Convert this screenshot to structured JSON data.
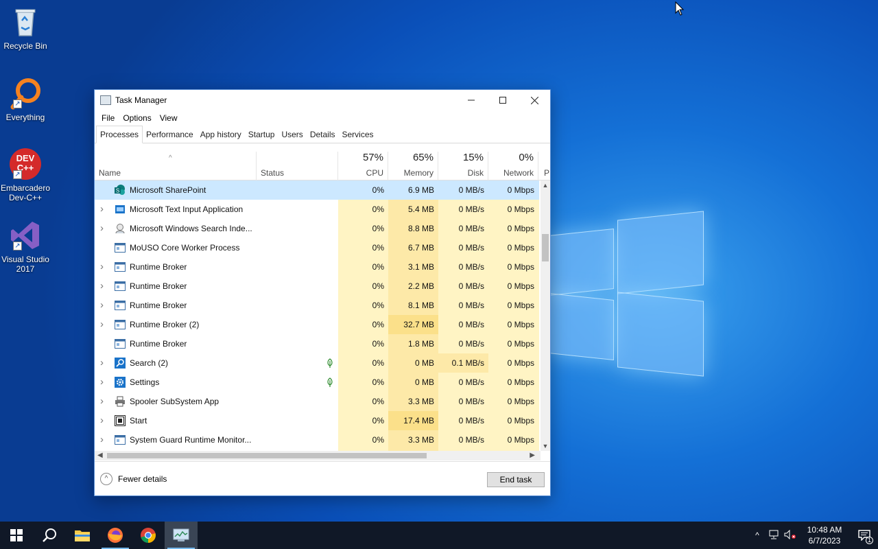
{
  "desktop": {
    "icons": [
      {
        "label": "Recycle Bin"
      },
      {
        "label": "Everything"
      },
      {
        "label": "Embarcadero Dev-C++",
        "glyph": "DEV C++"
      },
      {
        "label": "Visual Studio 2017"
      }
    ]
  },
  "window": {
    "title": "Task Manager",
    "menu": [
      "File",
      "Options",
      "View"
    ],
    "tabs": [
      "Processes",
      "Performance",
      "App history",
      "Startup",
      "Users",
      "Details",
      "Services"
    ],
    "active_tab": "Processes",
    "columns": {
      "name": "Name",
      "status": "Status",
      "cpu": {
        "pct": "57%",
        "label": "CPU"
      },
      "memory": {
        "pct": "65%",
        "label": "Memory"
      },
      "disk": {
        "pct": "15%",
        "label": "Disk"
      },
      "network": {
        "pct": "0%",
        "label": "Network"
      },
      "power": "P"
    },
    "processes": [
      {
        "name": "Microsoft SharePoint",
        "cpu": "0%",
        "memory": "6.9 MB",
        "disk": "0 MB/s",
        "network": "0 Mbps",
        "expandable": false,
        "icon": "sharepoint-icon",
        "selected": true
      },
      {
        "name": "Microsoft Text Input Application",
        "cpu": "0%",
        "memory": "5.4 MB",
        "disk": "0 MB/s",
        "network": "0 Mbps",
        "expandable": true,
        "icon": "app-icon"
      },
      {
        "name": "Microsoft Windows Search Inde...",
        "cpu": "0%",
        "memory": "8.8 MB",
        "disk": "0 MB/s",
        "network": "0 Mbps",
        "expandable": true,
        "icon": "search-indexer-icon"
      },
      {
        "name": "MoUSO Core Worker Process",
        "cpu": "0%",
        "memory": "6.7 MB",
        "disk": "0 MB/s",
        "network": "0 Mbps",
        "expandable": false,
        "icon": "process-icon"
      },
      {
        "name": "Runtime Broker",
        "cpu": "0%",
        "memory": "3.1 MB",
        "disk": "0 MB/s",
        "network": "0 Mbps",
        "expandable": true,
        "icon": "process-icon"
      },
      {
        "name": "Runtime Broker",
        "cpu": "0%",
        "memory": "2.2 MB",
        "disk": "0 MB/s",
        "network": "0 Mbps",
        "expandable": true,
        "icon": "process-icon"
      },
      {
        "name": "Runtime Broker",
        "cpu": "0%",
        "memory": "8.1 MB",
        "disk": "0 MB/s",
        "network": "0 Mbps",
        "expandable": true,
        "icon": "process-icon"
      },
      {
        "name": "Runtime Broker (2)",
        "cpu": "0%",
        "memory": "32.7 MB",
        "disk": "0 MB/s",
        "network": "0 Mbps",
        "expandable": true,
        "icon": "process-icon"
      },
      {
        "name": "Runtime Broker",
        "cpu": "0%",
        "memory": "1.8 MB",
        "disk": "0 MB/s",
        "network": "0 Mbps",
        "expandable": false,
        "icon": "process-icon"
      },
      {
        "name": "Search (2)",
        "cpu": "0%",
        "memory": "0 MB",
        "disk": "0.1 MB/s",
        "network": "0 Mbps",
        "expandable": true,
        "icon": "search-icon",
        "suspended": true
      },
      {
        "name": "Settings",
        "cpu": "0%",
        "memory": "0 MB",
        "disk": "0 MB/s",
        "network": "0 Mbps",
        "expandable": true,
        "icon": "gear-icon",
        "suspended": true
      },
      {
        "name": "Spooler SubSystem App",
        "cpu": "0%",
        "memory": "3.3 MB",
        "disk": "0 MB/s",
        "network": "0 Mbps",
        "expandable": true,
        "icon": "printer-icon"
      },
      {
        "name": "Start",
        "cpu": "0%",
        "memory": "17.4 MB",
        "disk": "0 MB/s",
        "network": "0 Mbps",
        "expandable": true,
        "icon": "start-app-icon"
      },
      {
        "name": "System Guard Runtime Monitor...",
        "cpu": "0%",
        "memory": "3.3 MB",
        "disk": "0 MB/s",
        "network": "0 Mbps",
        "expandable": true,
        "icon": "process-icon"
      }
    ],
    "footer": {
      "fewer_details": "Fewer details",
      "end_task": "End task"
    }
  },
  "taskbar": {
    "clock_time": "10:48 AM",
    "clock_date": "6/7/2023",
    "notification_count": "1"
  }
}
